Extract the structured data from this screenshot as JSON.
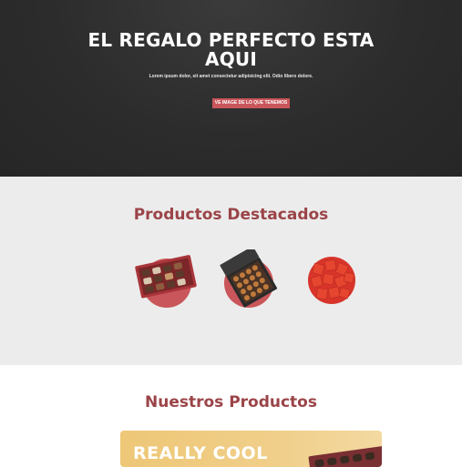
{
  "hero": {
    "title_line1": "EL REGALO PERFECTO ESTA",
    "title_line2": "AQUI",
    "subtitle": "Lorem ipsum dolor, sit amet consectetur adipisicing elit. Odio libero dolore.",
    "button_label": "VE IMAGE DE LO QUE TENEMOS"
  },
  "featured": {
    "title": "Productos Destacados",
    "products": [
      {
        "icon": "chocolate-box-icon"
      },
      {
        "icon": "open-chocolate-box-icon"
      },
      {
        "icon": "red-candy-icon"
      }
    ]
  },
  "ours": {
    "title": "Nuestros Productos",
    "banner_text": "REALLY COOL"
  },
  "colors": {
    "accent": "#c9565a",
    "title_red": "#9b4448",
    "hero_bg": "#2c2c2c",
    "featured_bg": "#ececec",
    "banner_gold": "#eec777"
  }
}
